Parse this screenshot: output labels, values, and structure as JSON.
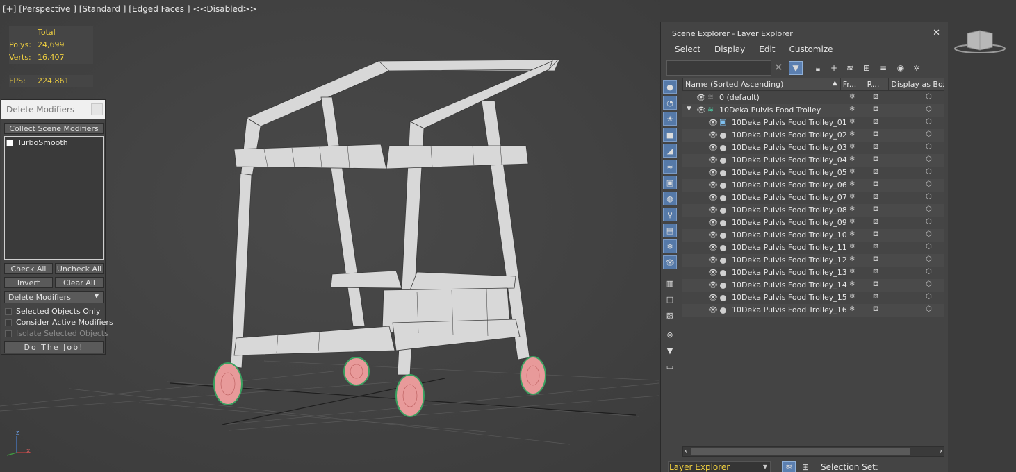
{
  "viewport": {
    "label": "[+] [Perspective ] [Standard ] [Edged Faces ]  <<Disabled>>",
    "stats": {
      "header": "Total",
      "polys_label": "Polys:",
      "polys_value": "24,699",
      "verts_label": "Verts:",
      "verts_value": "16,407",
      "fps_label": "FPS:",
      "fps_value": "224.861"
    },
    "axis_x": "x",
    "axis_z": "z"
  },
  "delete_modifiers": {
    "title": "Delete Modifiers",
    "collect_button": "Collect Scene Modifiers",
    "list_items": [
      {
        "label": "TurboSmooth",
        "checked": false
      }
    ],
    "check_all": "Check All",
    "uncheck_all": "Uncheck All",
    "invert": "Invert",
    "clear_all": "Clear All",
    "mode_select": "Delete Modifiers",
    "selected_only": "Selected Objects Only",
    "consider_active": "Consider Active Modifiers",
    "isolate_selected": "Isolate Selected Objects",
    "do_job": "Do The Job!"
  },
  "scene_explorer": {
    "title": "Scene Explorer - Layer Explorer",
    "menu": [
      "Select",
      "Display",
      "Edit",
      "Customize"
    ],
    "search_value": "",
    "columns": {
      "name": "Name (Sorted Ascending)",
      "frozen": "Fr...",
      "render": "R...",
      "display_as_box": "Display as Box"
    },
    "default_layer": "0 (default)",
    "group_layer": "10Deka Pulvis Food Trolley",
    "objects": [
      "10Deka Pulvis Food Trolley_01",
      "10Deka Pulvis Food Trolley_02",
      "10Deka Pulvis Food Trolley_03",
      "10Deka Pulvis Food Trolley_04",
      "10Deka Pulvis Food Trolley_05",
      "10Deka Pulvis Food Trolley_06",
      "10Deka Pulvis Food Trolley_07",
      "10Deka Pulvis Food Trolley_08",
      "10Deka Pulvis Food Trolley_09",
      "10Deka Pulvis Food Trolley_10",
      "10Deka Pulvis Food Trolley_11",
      "10Deka Pulvis Food Trolley_12",
      "10Deka Pulvis Food Trolley_13",
      "10Deka Pulvis Food Trolley_14",
      "10Deka Pulvis Food Trolley_15",
      "10Deka Pulvis Food Trolley_16"
    ],
    "explorer_select": "Layer Explorer",
    "selection_set_label": "Selection Set:"
  },
  "colors": {
    "stats_text": "#f0d040",
    "viewport_bg": "#434343",
    "panel_bg": "#444444",
    "active_blue": "#5b7fb0",
    "wheel_pink": "#e89a9a",
    "wheel_green": "#3aa060"
  }
}
